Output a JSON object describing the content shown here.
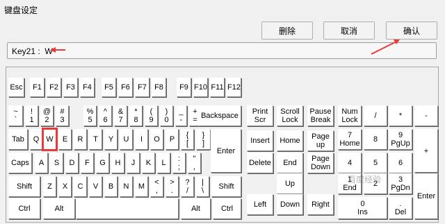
{
  "window": {
    "title": "键盘设定"
  },
  "toolbar": {
    "delete_label": "删除",
    "cancel_label": "取消",
    "confirm_label": "确认"
  },
  "status": {
    "text": "Key21 :  W"
  },
  "watermark": "百度经验",
  "colors": {
    "annotation_red": "#e83a3a",
    "background": "#f0f0f0"
  },
  "keys": [
    {
      "label": "Esc"
    },
    {
      "label": "F1"
    },
    {
      "label": "F2"
    },
    {
      "label": "F3"
    },
    {
      "label": "F4"
    },
    {
      "label": "F5"
    },
    {
      "label": "F6"
    },
    {
      "label": "F7"
    },
    {
      "label": "F8"
    },
    {
      "label": "F9"
    },
    {
      "label": "F10"
    },
    {
      "label": "F11"
    },
    {
      "label": "F12"
    },
    {
      "label": "~\n`"
    },
    {
      "label": "!\n1"
    },
    {
      "label": "@\n2"
    },
    {
      "label": "#\n3"
    },
    {
      "label": "%\n5"
    },
    {
      "label": "^\n6"
    },
    {
      "label": "&\n7"
    },
    {
      "label": "*\n8"
    },
    {
      "label": "(\n9"
    },
    {
      "label": ")\n0"
    },
    {
      "label": "_\n-"
    },
    {
      "label": "+\n="
    },
    {
      "label": "Backspace"
    },
    {
      "label": "Tab"
    },
    {
      "label": "Q"
    },
    {
      "label": "W"
    },
    {
      "label": "E"
    },
    {
      "label": "R"
    },
    {
      "label": "T"
    },
    {
      "label": "Y"
    },
    {
      "label": "U"
    },
    {
      "label": "I"
    },
    {
      "label": "O"
    },
    {
      "label": "P"
    },
    {
      "label": "{\n["
    },
    {
      "label": "}\n]"
    },
    {
      "label": "Enter"
    },
    {
      "label": "Caps"
    },
    {
      "label": "A"
    },
    {
      "label": "S"
    },
    {
      "label": "D"
    },
    {
      "label": "F"
    },
    {
      "label": "G"
    },
    {
      "label": "H"
    },
    {
      "label": "J"
    },
    {
      "label": "K"
    },
    {
      "label": "L"
    },
    {
      "label": ":\n;"
    },
    {
      "label": "\"\n,"
    },
    {
      "label": "Shift"
    },
    {
      "label": "Z"
    },
    {
      "label": "X"
    },
    {
      "label": "C"
    },
    {
      "label": "V"
    },
    {
      "label": "B"
    },
    {
      "label": "N"
    },
    {
      "label": "M"
    },
    {
      "label": "<\n,"
    },
    {
      "label": ">\n."
    },
    {
      "label": "?\n/"
    },
    {
      "label": "|\n\\"
    },
    {
      "label": "Shift"
    },
    {
      "label": "Ctrl"
    },
    {
      "label": "Alt"
    },
    {
      "label": ""
    },
    {
      "label": "Alt"
    },
    {
      "label": "Ctrl"
    },
    {
      "label": "Print\nScr"
    },
    {
      "label": "Scroll\nLock"
    },
    {
      "label": "Pause\nBreak"
    },
    {
      "label": "Insert"
    },
    {
      "label": "Home"
    },
    {
      "label": "Page\nup"
    },
    {
      "label": "Delete"
    },
    {
      "label": "End"
    },
    {
      "label": "Page\nDown"
    },
    {
      "label": "Up"
    },
    {
      "label": "Left"
    },
    {
      "label": "Down"
    },
    {
      "label": "Right"
    },
    {
      "label": "Num\nLock"
    },
    {
      "label": "/"
    },
    {
      "label": "*"
    },
    {
      "label": "-"
    },
    {
      "label": "7\nHome"
    },
    {
      "label": "8"
    },
    {
      "label": "9\nPgUp"
    },
    {
      "label": "+"
    },
    {
      "label": "4"
    },
    {
      "label": "5"
    },
    {
      "label": "6"
    },
    {
      "label": "1\nEnd"
    },
    {
      "label": "2"
    },
    {
      "label": "3\nPgDn"
    },
    {
      "label": "Enter"
    },
    {
      "label": "0\nIns"
    },
    {
      "label": ".\nDel"
    }
  ]
}
